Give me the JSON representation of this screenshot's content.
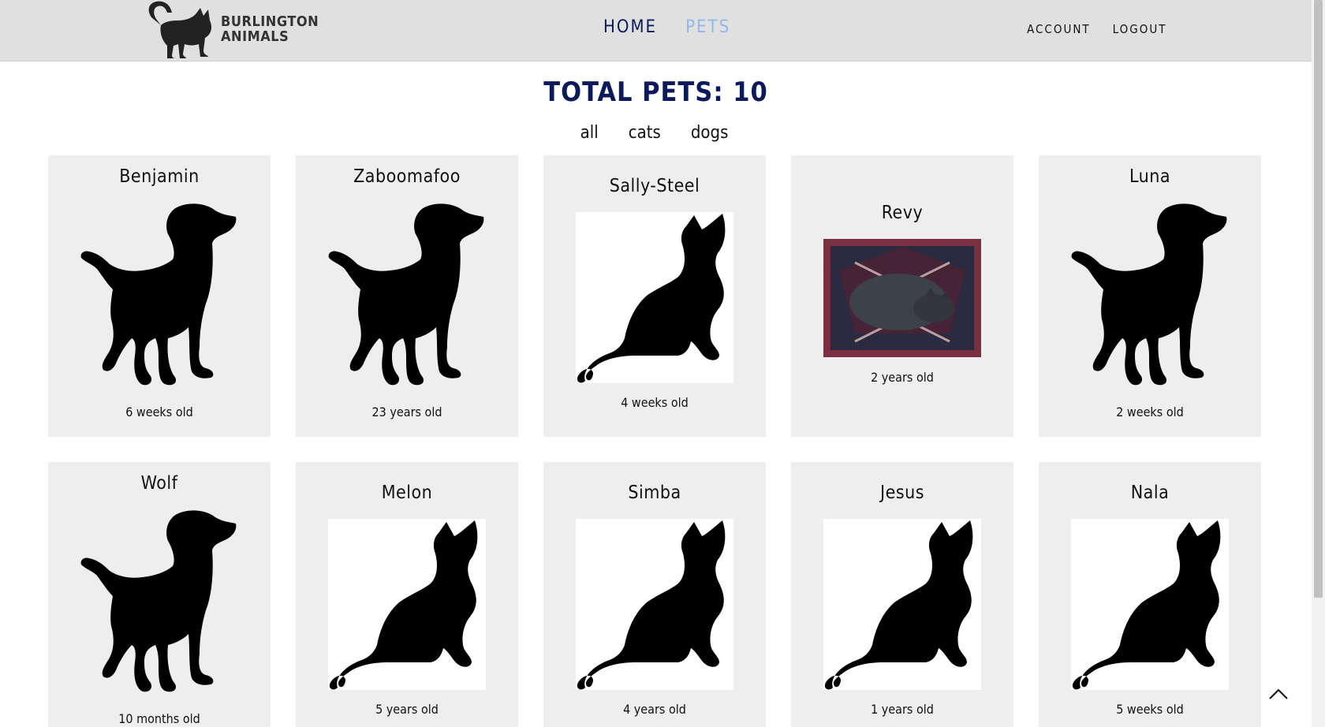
{
  "brand": {
    "line1": "BURLINGTON",
    "line2": "ANIMALS",
    "logo_icon": "cat-silhouette-logo"
  },
  "nav": {
    "home": "HOME",
    "pets": "PETS",
    "account": "ACCOUNT",
    "logout": "LOGOUT",
    "active": "PETS",
    "active_color": "#8fb8ef",
    "primary_color": "#0a1a5c"
  },
  "main": {
    "title": "TOTAL PETS: 10",
    "filters": [
      "all",
      "cats",
      "dogs"
    ]
  },
  "pets": [
    {
      "name": "Benjamin",
      "age": "6 weeks old",
      "image": "dog-silhouette"
    },
    {
      "name": "Zaboomafoo",
      "age": "23 years old",
      "image": "dog-silhouette"
    },
    {
      "name": "Sally-Steel",
      "age": "4 weeks old",
      "image": "cat-silhouette"
    },
    {
      "name": "Revy",
      "age": "2 years old",
      "image": "photo-black-cat-on-rug"
    },
    {
      "name": "Luna",
      "age": "2 weeks old",
      "image": "dog-silhouette"
    },
    {
      "name": "Wolf",
      "age": "10 months old",
      "image": "dog-silhouette"
    },
    {
      "name": "Melon",
      "age": "5 years old",
      "image": "cat-silhouette"
    },
    {
      "name": "Simba",
      "age": "4 years old",
      "image": "cat-silhouette"
    },
    {
      "name": "Jesus",
      "age": "1 years old",
      "image": "cat-silhouette"
    },
    {
      "name": "Nala",
      "age": "5 weeks old",
      "image": "cat-silhouette"
    }
  ],
  "back_to_top_icon": "chevron-up-icon"
}
